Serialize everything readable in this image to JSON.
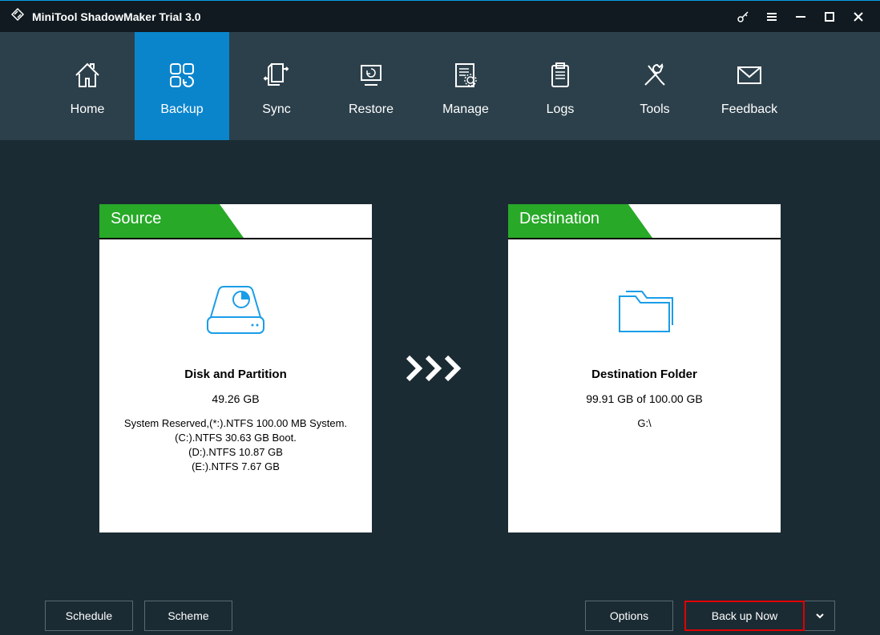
{
  "app": {
    "title": "MiniTool ShadowMaker Trial 3.0"
  },
  "nav": [
    {
      "label": "Home"
    },
    {
      "label": "Backup"
    },
    {
      "label": "Sync"
    },
    {
      "label": "Restore"
    },
    {
      "label": "Manage"
    },
    {
      "label": "Logs"
    },
    {
      "label": "Tools"
    },
    {
      "label": "Feedback"
    }
  ],
  "source": {
    "header": "Source",
    "title": "Disk and Partition",
    "size": "49.26 GB",
    "line1": "System Reserved,(*:).NTFS 100.00 MB System.",
    "line2": "(C:).NTFS 30.63 GB Boot.",
    "line3": "(D:).NTFS 10.87 GB",
    "line4": "(E:).NTFS 7.67 GB"
  },
  "destination": {
    "header": "Destination",
    "title": "Destination Folder",
    "size": "99.91 GB of 100.00 GB",
    "path": "G:\\"
  },
  "footer": {
    "schedule": "Schedule",
    "scheme": "Scheme",
    "options": "Options",
    "backup": "Back up Now"
  }
}
